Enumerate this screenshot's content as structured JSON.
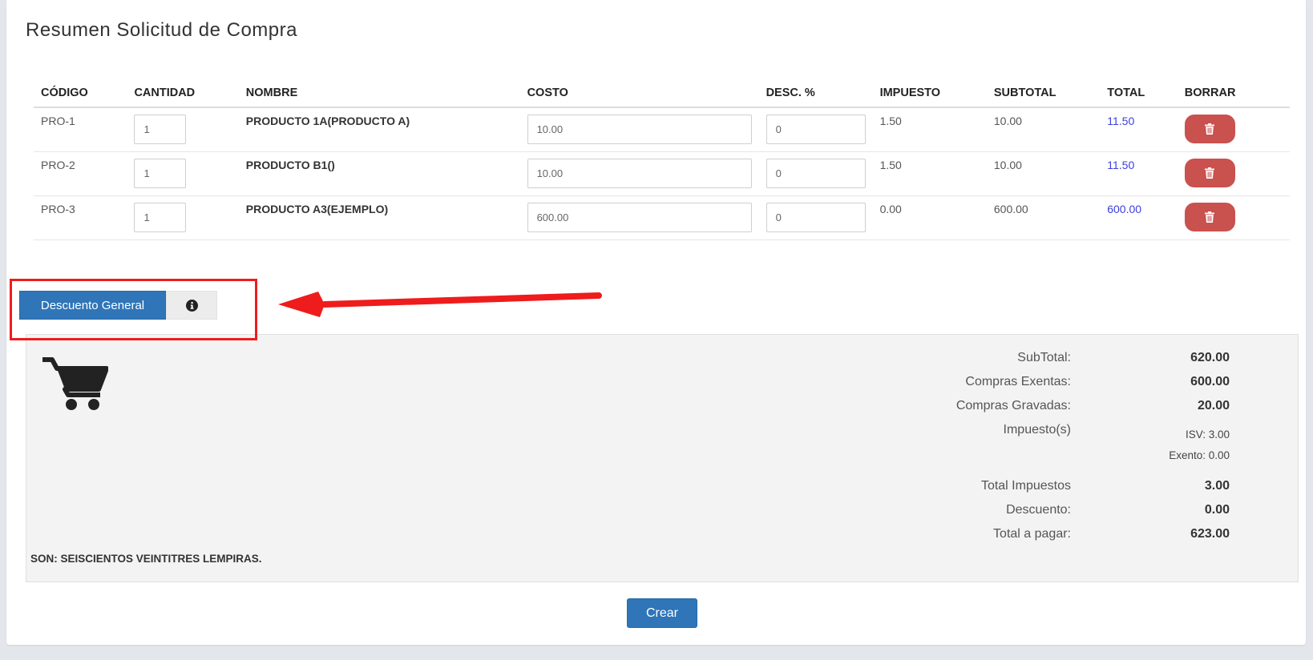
{
  "page": {
    "title": "Resumen Solicitud de Compra"
  },
  "table": {
    "headers": [
      "CÓDIGO",
      "CANTIDAD",
      "NOMBRE",
      "COSTO",
      "DESC. %",
      "IMPUESTO",
      "SUBTOTAL",
      "TOTAL",
      "BORRAR"
    ],
    "rows": [
      {
        "code": "PRO-1",
        "qty": "1",
        "name": "PRODUCTO 1A(PRODUCTO A)",
        "cost": "10.00",
        "disc": "0",
        "tax": "1.50",
        "subtotal": "10.00",
        "total": "11.50"
      },
      {
        "code": "PRO-2",
        "qty": "1",
        "name": "PRODUCTO B1()",
        "cost": "10.00",
        "disc": "0",
        "tax": "1.50",
        "subtotal": "10.00",
        "total": "11.50"
      },
      {
        "code": "PRO-3",
        "qty": "1",
        "name": "PRODUCTO A3(EJEMPLO)",
        "cost": "600.00",
        "disc": "0",
        "tax": "0.00",
        "subtotal": "600.00",
        "total": "600.00"
      }
    ],
    "delete_icon": "trash-icon"
  },
  "discount": {
    "button_label": "Descuento General",
    "info_icon": "info-circle-icon"
  },
  "summary": {
    "subtotal_label": "SubTotal:",
    "subtotal_value": "620.00",
    "exentas_label": "Compras Exentas:",
    "exentas_value": "600.00",
    "gravadas_label": "Compras Gravadas:",
    "gravadas_value": "20.00",
    "impuestos_label": "Impuesto(s)",
    "isv": "ISV: 3.00",
    "exento": "Exento: 0.00",
    "total_impuestos_label": "Total Impuestos",
    "total_impuestos_value": "3.00",
    "descuento_label": "Descuento:",
    "descuento_value": "0.00",
    "total_pagar_label": "Total a pagar:",
    "total_pagar_value": "623.00",
    "son_text": "SON: SEISCIENTOS VEINTITRES LEMPIRAS.",
    "cart_icon": "shopping-cart-icon"
  },
  "actions": {
    "create_label": "Crear"
  },
  "colors": {
    "primary": "#2f75b8",
    "danger": "#c9514e",
    "highlight": "#ee1c1c",
    "link": "#3b3fdc"
  }
}
